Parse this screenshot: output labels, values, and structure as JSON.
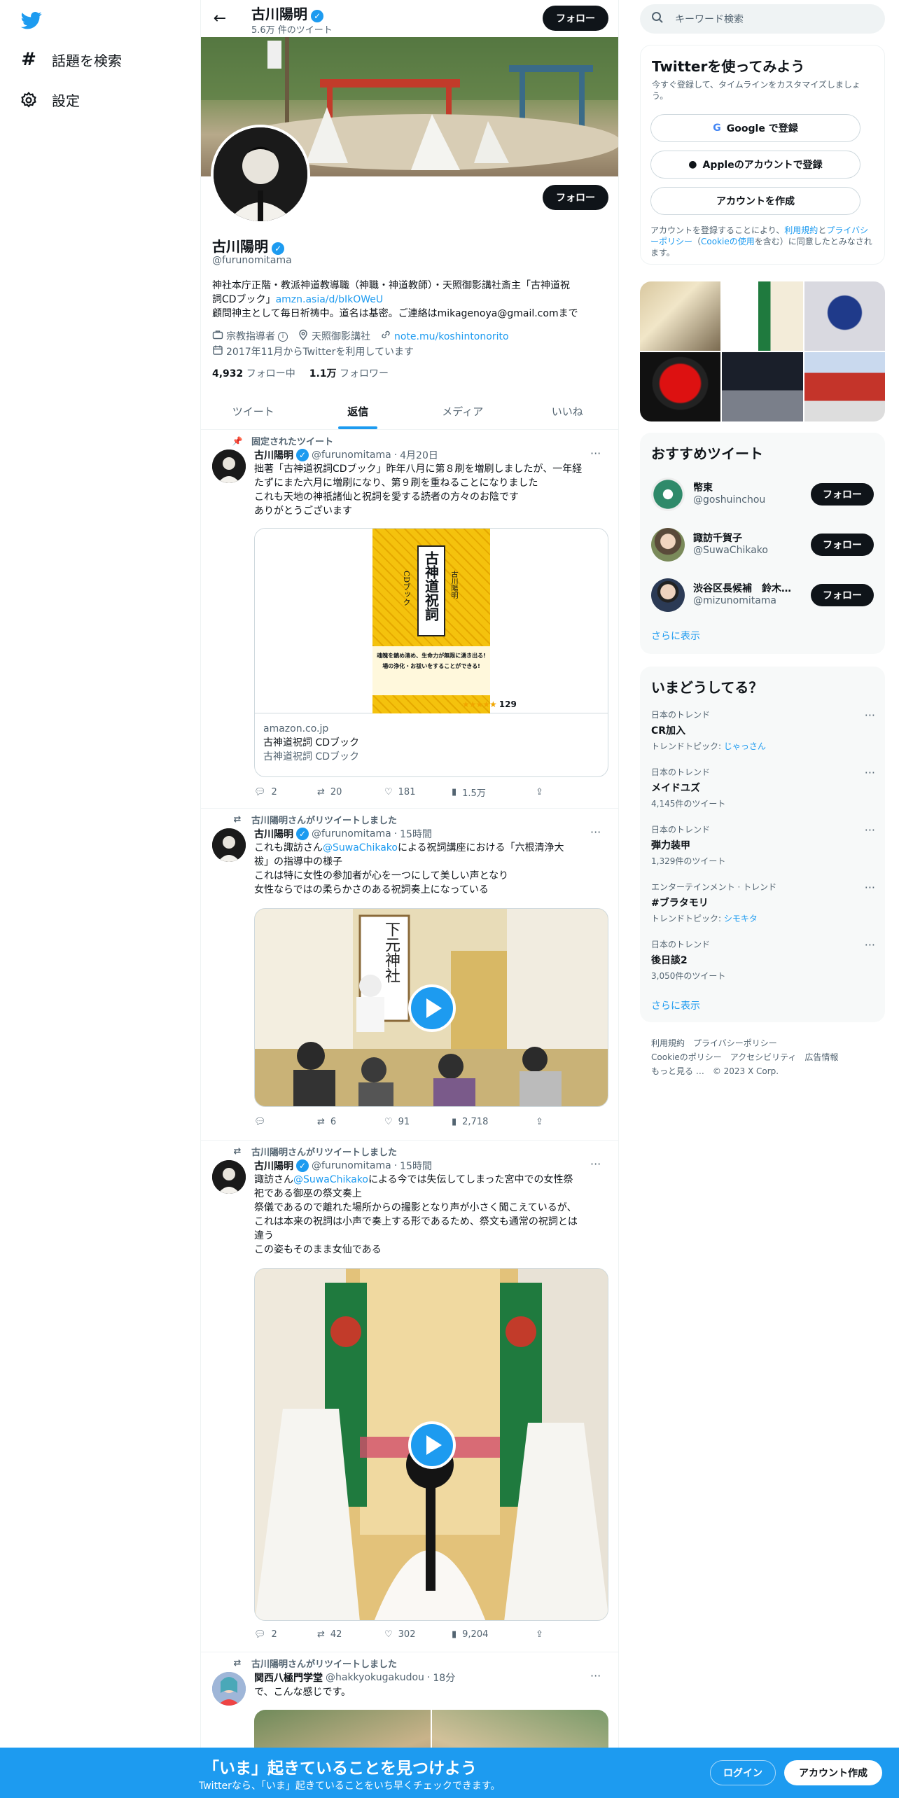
{
  "nav": {
    "search_label": "話題を検索",
    "settings_label": "設定"
  },
  "header": {
    "name": "古川陽明",
    "tweet_count": "5.6万 件のツイート",
    "follow_label": "フォロー"
  },
  "profile": {
    "name": "古川陽明",
    "handle": "@furunomitama",
    "follow_label": "フォロー",
    "bio_line1": "神社本庁正階・教派神道教導職（神職・神道教師）・天照御影講社斎主「古神道祝",
    "bio_line2_prefix": "詞CDブック」",
    "bio_link": "amzn.asia/d/bIkOWeU",
    "bio_line3": "顧問神主として毎日祈祷中。道名は基密。ご連絡はmikagenoya@gmail.comまで",
    "category": "宗教指導者",
    "location": "天照御影講社",
    "website": "note.mu/koshintonorito",
    "joined": "2017年11月からTwitterを利用しています",
    "following_count": "4,932",
    "following_label": "フォロー中",
    "followers_count": "1.1万",
    "followers_label": "フォロワー"
  },
  "tabs": [
    "ツイート",
    "返信",
    "メディア",
    "いいね"
  ],
  "tweets": [
    {
      "context": "固定されたツイート",
      "name": "古川陽明",
      "handle": "@furunomitama",
      "time": "4月20日",
      "text": [
        "拙著「古神道祝詞CDブック」昨年八月に第８刷を増刷しましたが、一年経",
        "たずにまた六月に増刷になり、第９刷を重ねることになりました",
        "これも天地の神祇諸仙と祝詞を愛する読者の方々のお陰です",
        "ありがとうございます"
      ],
      "card_domain": "amazon.co.jp",
      "card_title": "古神道祝詞 CDブック",
      "card_desc": "古神道祝詞 CDブック",
      "book_title": "古神道祝詞",
      "book_sub": "CDブック",
      "book_author": "古川陽明",
      "book_blurb1": "魂魄を鎮め清め、生命力が無限に湧き出る!",
      "book_blurb2": "場の浄化・お祓いをすることができる!",
      "book_rating": "129",
      "replies": "2",
      "retweets": "20",
      "likes": "181",
      "views": "1.5万"
    },
    {
      "context": "古川陽明さんがリツイートしました",
      "name": "古川陽明",
      "handle": "@furunomitama",
      "time": "15時間",
      "text_prefix": "これも諏訪さん",
      "mention": "@SuwaChikako",
      "text_suffix": "による祝詞講座における「六根清浄大",
      "text": [
        "祓」の指導中の様子",
        "これは特に女性の参加者が心を一つにして美しい声となり",
        "女性ならではの柔らかさのある祝詞奏上になっている"
      ],
      "scroll_text": "下元神社",
      "replies": "",
      "retweets": "6",
      "likes": "91",
      "views": "2,718"
    },
    {
      "context": "古川陽明さんがリツイートしました",
      "name": "古川陽明",
      "handle": "@furunomitama",
      "time": "15時間",
      "text_prefix": "諏訪さん",
      "mention": "@SuwaChikako",
      "text_suffix": "による今では失伝してしまった宮中での女性祭",
      "text": [
        "祀である御巫の祭文奏上",
        "祭儀であるので離れた場所からの撮影となり声が小さく聞こえているが、",
        "これは本来の祝詞は小声で奏上する形であるため、祭文も通常の祝詞とは",
        "違う",
        "この姿もそのまま女仙である"
      ],
      "replies": "2",
      "retweets": "42",
      "likes": "302",
      "views": "9,204"
    },
    {
      "context": "古川陽明さんがリツイートしました",
      "name": "関西八極門学堂",
      "handle": "@hakkyokugakudou",
      "time": "18分",
      "text": [
        "で、こんな感じです。"
      ]
    }
  ],
  "search": {
    "placeholder": "キーワード検索"
  },
  "signup": {
    "title": "Twitterを使ってみよう",
    "subtitle": "今すぐ登録して、タイムラインをカスタマイズしましょう。",
    "google_label": "Google で登録",
    "apple_label": "Appleのアカウントで登録",
    "create_label": "アカウントを作成",
    "legal_prefix": "アカウントを登録することにより、",
    "legal_terms": "利用規約",
    "legal_and": "と",
    "legal_privacy": "プライバシーポリシー",
    "legal_cookie_open": "（",
    "legal_cookie": "Cookieの使用",
    "legal_suffix": "を含む）に同意したとみなされます。"
  },
  "recommend": {
    "title": "おすすめツイート",
    "users": [
      {
        "name": "幣束",
        "handle": "@goshuinchou",
        "follow": "フォロー"
      },
      {
        "name": "諏訪千賀子",
        "handle": "@SuwaChikako",
        "follow": "フォロー"
      },
      {
        "name": "渋谷区長候補　鈴木…",
        "handle": "@mizunomitama",
        "follow": "フォロー"
      }
    ],
    "more": "さらに表示"
  },
  "trends": {
    "title": "いまどうしてる？",
    "items": [
      {
        "context": "日本のトレンド",
        "name": "CR加入",
        "meta_prefix": "トレンドトピック: ",
        "meta_link": "じゃっさん"
      },
      {
        "context": "日本のトレンド",
        "name": "メイドユズ",
        "meta": "4,145件のツイート"
      },
      {
        "context": "日本のトレンド",
        "name": "弾力装甲",
        "meta": "1,329件のツイート"
      },
      {
        "context": "エンターテインメント · トレンド",
        "name": "#ブラタモリ",
        "meta_prefix": "トレンドトピック: ",
        "meta_link": "シモキタ"
      },
      {
        "context": "日本のトレンド",
        "name": "後日談2",
        "meta": "3,050件のツイート"
      }
    ],
    "more": "さらに表示"
  },
  "footer": {
    "links": [
      "利用規約",
      "プライバシーポリシー",
      "Cookieのポリシー",
      "アクセシビリティ",
      "広告情報",
      "もっと見る …"
    ],
    "copyright": "© 2023 X Corp."
  },
  "bottom_bar": {
    "title": "「いま」起きていることを見つけよう",
    "subtitle": "Twitterなら、「いま」起きていることをいち早くチェックできます。",
    "login": "ログイン",
    "signup": "アカウント作成"
  },
  "colors": {
    "accent": "#1d9bf0",
    "text": "#0f1419",
    "muted": "#536471",
    "border": "#eff3f4"
  }
}
